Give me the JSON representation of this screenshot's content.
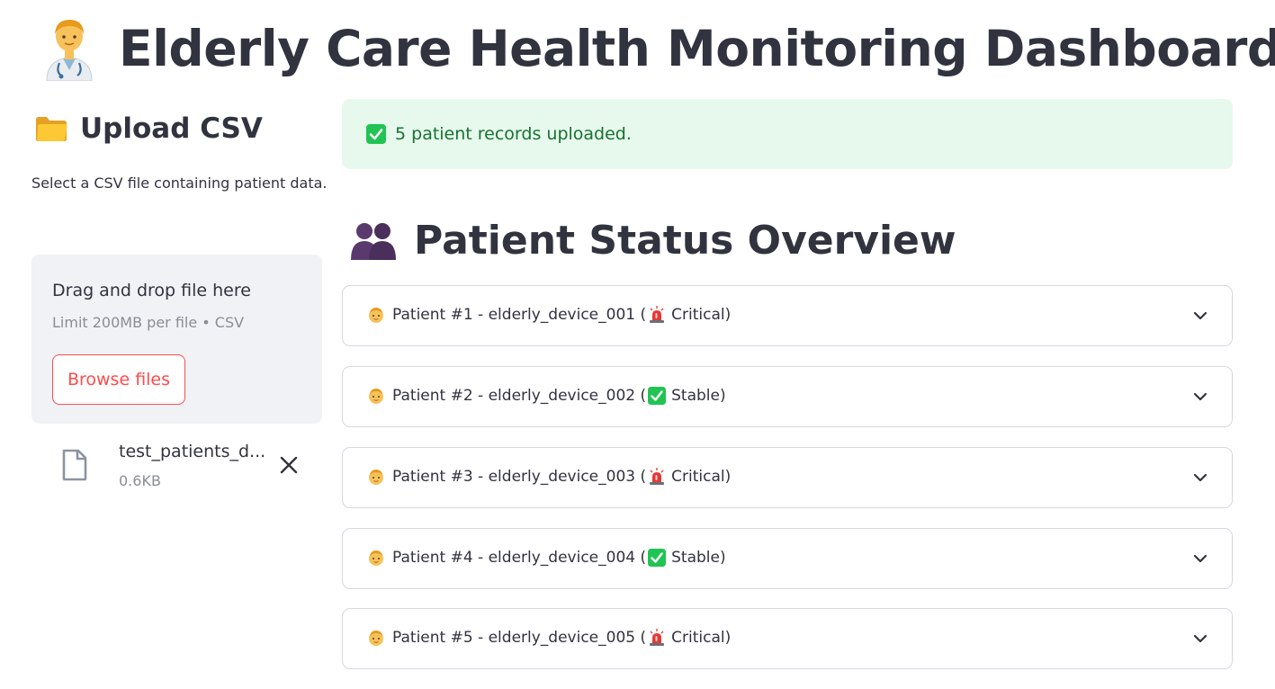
{
  "header": {
    "title": "Elderly Care Health Monitoring Dashboard",
    "title_icon": "doctor-icon"
  },
  "sidebar": {
    "upload_title": "Upload CSV",
    "upload_icon": "folder-icon",
    "description": "Select a CSV file containing patient data.",
    "dropzone": {
      "main_text": "Drag and drop file here",
      "limit_text": "Limit 200MB per file • CSV",
      "browse_label": "Browse files"
    },
    "file": {
      "name": "test_patients_d...",
      "size": "0.6KB"
    }
  },
  "main": {
    "success_message": "5 patient records uploaded.",
    "section_title": "Patient Status Overview",
    "patients": [
      {
        "label": "Patient #1 - elderly_device_001 (",
        "status_icon": "siren-icon",
        "status": "Critical)"
      },
      {
        "label": "Patient #2 - elderly_device_002 (",
        "status_icon": "check-icon",
        "status": "Stable)"
      },
      {
        "label": "Patient #3 - elderly_device_003 (",
        "status_icon": "siren-icon",
        "status": "Critical)"
      },
      {
        "label": "Patient #4 - elderly_device_004 (",
        "status_icon": "check-icon",
        "status": "Stable)"
      },
      {
        "label": "Patient #5 - elderly_device_005 (",
        "status_icon": "siren-icon",
        "status": "Critical)"
      }
    ]
  },
  "colors": {
    "accent": "#ff4b4b",
    "success_bg": "#e7f8ec",
    "success_text": "#177233",
    "text": "#31333f",
    "muted": "#8a8d96",
    "dropzone_bg": "#f0f2f6"
  }
}
